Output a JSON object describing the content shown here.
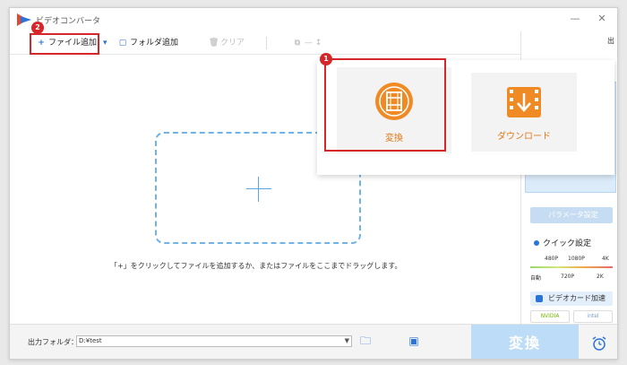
{
  "window": {
    "title": "ビデオコンバータ"
  },
  "window_controls": {
    "minimize": "—",
    "close": "✕"
  },
  "toolbar": {
    "add_file": "ファイル追加",
    "add_folder": "フォルダ追加",
    "clear": "クリア",
    "more": "—  ↕"
  },
  "markers": {
    "step1": "1",
    "step2": "2"
  },
  "popup": {
    "convert_label": "変換",
    "download_label": "ダウンロード"
  },
  "drop_area": {
    "hint": "「+」をクリックしてファイルを追加するか、またはファイルをここまでドラッグします。"
  },
  "right_panel": {
    "param_settings": "パラメータ設定",
    "quick_settings": "クイック設定",
    "ticks_top": [
      "480P",
      "1080P",
      "4K"
    ],
    "ticks_bottom": [
      "自動",
      "720P",
      "2K"
    ],
    "gpu_accel": "ビデオカード加速",
    "vendors": [
      "NVIDIA",
      "intel"
    ]
  },
  "bottom": {
    "output_folder_label": "出力フォルダ：",
    "output_folder_value": "D:¥test",
    "convert_button": "変換"
  },
  "colors": {
    "accent": "#2a73d9",
    "highlight_red": "#d6262a",
    "orange": "#f08a24",
    "convert_disabled": "#bcdcf7"
  }
}
